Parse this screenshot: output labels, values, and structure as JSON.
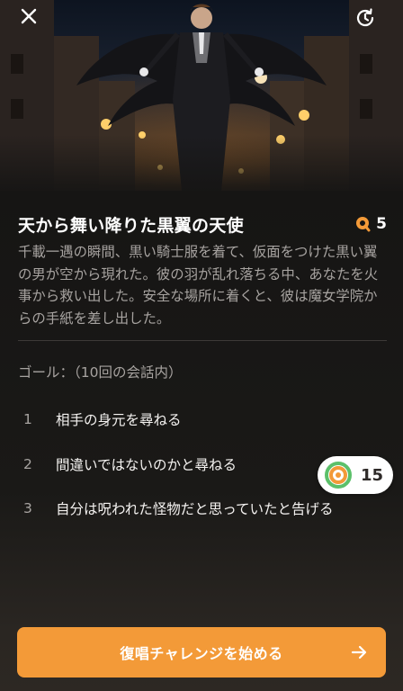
{
  "hero": {
    "close_icon": "close-icon",
    "history_icon": "history-icon"
  },
  "story": {
    "title": "天から舞い降りた黒翼の天使",
    "coins": "5",
    "description": "千載一遇の瞬間、黒い騎士服を着て、仮面をつけた黒い翼の男が空から現れた。彼の羽が乱れ落ちる中、あなたを火事から救い出した。安全な場所に着くと、彼は魔女学院からの手紙を差し出した。"
  },
  "goals": {
    "label": "ゴール：（10回の会話内）",
    "items": [
      {
        "num": "1",
        "text": "相手の身元を尋ねる"
      },
      {
        "num": "2",
        "text": "間違いではないのかと尋ねる"
      },
      {
        "num": "3",
        "text": "自分は呪われた怪物だと思っていたと告げる"
      }
    ]
  },
  "badge": {
    "value": "15"
  },
  "start_button": {
    "label": "復唱チャレンジを始める"
  },
  "colors": {
    "accent": "#f39a38",
    "ring_green": "#5cc06a"
  }
}
